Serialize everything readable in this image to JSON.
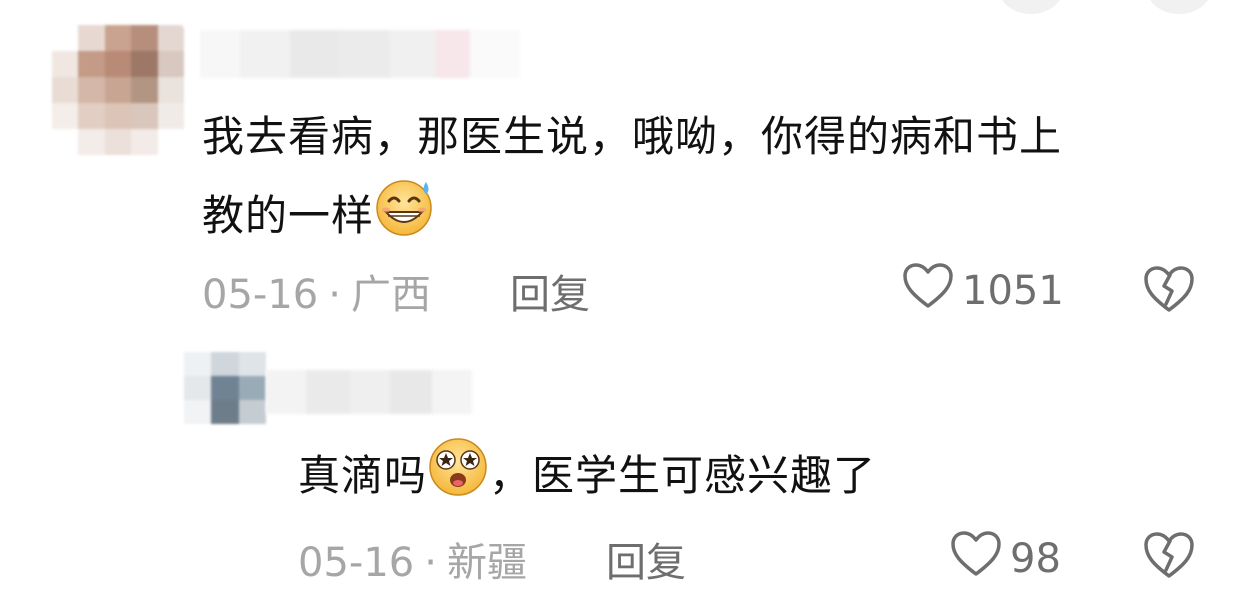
{
  "comments": [
    {
      "text_line1": "我去看病，那医生说，哦呦，你得的病和书上",
      "text_line2": "教的一样",
      "emoji": "sweat-grin-emoji",
      "date": "05-16",
      "location": "广西",
      "reply_label": "回复",
      "likes": "1051"
    }
  ],
  "replies": [
    {
      "text_before": "真滴吗",
      "emoji": "star-eyes-emoji",
      "text_after": "，医学生可感兴趣了",
      "date": "05-16",
      "location": "新疆",
      "reply_label": "回复",
      "likes": "98"
    }
  ],
  "separator": "·",
  "icons": {
    "like": "heart-outline-icon",
    "dislike": "broken-heart-icon"
  },
  "colors": {
    "text": "#111111",
    "meta": "#a6a6a6",
    "action": "#6e6e6e"
  }
}
